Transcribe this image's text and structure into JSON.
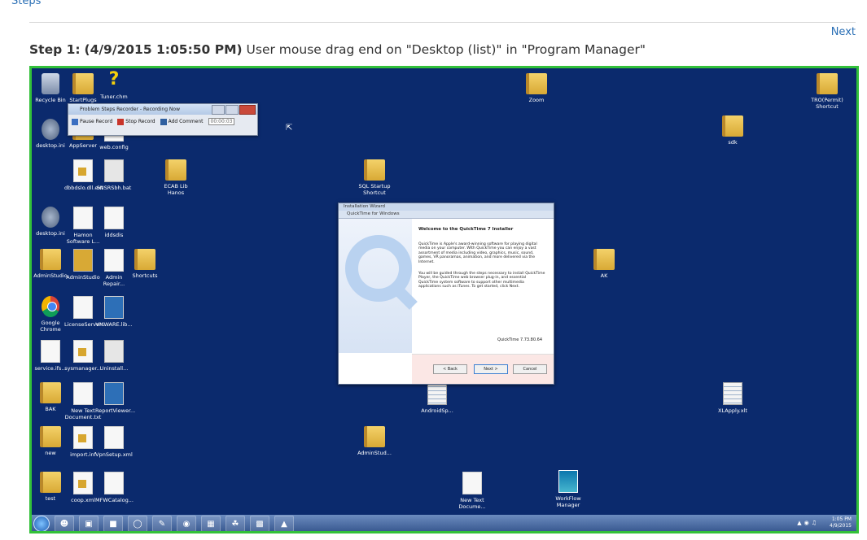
{
  "top_link": "Steps",
  "nav": {
    "next_label": "Next"
  },
  "step": {
    "prefix": "Step 1:",
    "timestamp": "(4/9/2015 1:05:50 PM)",
    "description": "User mouse drag end on \"Desktop (list)\" in \"Program Manager\""
  },
  "desktop_icons": [
    {
      "id": "recycle-bin",
      "label": "Recycle Bin",
      "icon": "bin"
    },
    {
      "id": "startplugs",
      "label": "StartPlugs",
      "icon": "folder"
    },
    {
      "id": "tuner-chm",
      "label": "Tuner.chm",
      "icon": "qmark"
    },
    {
      "id": "zoom",
      "label": "Zoom",
      "icon": "folder"
    },
    {
      "id": "tro-shortcut",
      "label": "TRO(Permit) Shortcut",
      "icon": "folder"
    },
    {
      "id": "desktop-ini-1",
      "label": "desktop.ini",
      "icon": "globe"
    },
    {
      "id": "appserver",
      "label": "AppServer",
      "icon": "folder"
    },
    {
      "id": "web-config",
      "label": "web.config",
      "icon": "doc"
    },
    {
      "id": "sdk",
      "label": "sdk",
      "icon": "folder"
    },
    {
      "id": "sql-lic",
      "label": "dbbdslo.dll.ext",
      "icon": "docy"
    },
    {
      "id": "sqlsetup",
      "label": "SNSRSbh.bat",
      "icon": "cfg"
    },
    {
      "id": "ecab-shares",
      "label": "ECAB Lib Hanos",
      "icon": "folder"
    },
    {
      "id": "sql-startup",
      "label": "SQL Startup Shortcut",
      "icon": "folder"
    },
    {
      "id": "desktop-ini-2",
      "label": "desktop.ini",
      "icon": "globe"
    },
    {
      "id": "hamon-software",
      "label": "Hamon Software L...",
      "icon": "doc"
    },
    {
      "id": "iddsdis",
      "label": "iddsdis",
      "icon": "doc"
    },
    {
      "id": "admin-studio",
      "label": "AdminStudio",
      "icon": "folder"
    },
    {
      "id": "admin-studio-2",
      "label": "AdminStudio",
      "icon": "cfg"
    },
    {
      "id": "admin-repair",
      "label": "Admin Repair...",
      "icon": "doc"
    },
    {
      "id": "shortcuts",
      "label": "Shortcuts",
      "icon": "folder"
    },
    {
      "id": "ak",
      "label": "AK",
      "icon": "folder"
    },
    {
      "id": "google-chrome",
      "label": "Google Chrome",
      "icon": "chrome"
    },
    {
      "id": "license-server",
      "label": "LicenseServer...",
      "icon": "doc"
    },
    {
      "id": "vmware-file",
      "label": "VMWARE.lib...",
      "icon": "mw"
    },
    {
      "id": "service-file",
      "label": "service.ifs...",
      "icon": "doc"
    },
    {
      "id": "sysmanager",
      "label": "sysmanager...",
      "icon": "docy"
    },
    {
      "id": "uninstall",
      "label": "Uninstall...",
      "icon": "cfg"
    },
    {
      "id": "bak",
      "label": "BAK",
      "icon": "folder"
    },
    {
      "id": "new-text-doc-1",
      "label": "New Text Document.txt",
      "icon": "doc"
    },
    {
      "id": "report-viewer",
      "label": "ReportViewer...",
      "icon": "mw"
    },
    {
      "id": "android-sp",
      "label": "AndroidSp...",
      "icon": "sheet"
    },
    {
      "id": "xl-apply",
      "label": "XLApply.xlt",
      "icon": "sheet"
    },
    {
      "id": "new",
      "label": "new",
      "icon": "folder"
    },
    {
      "id": "import-info",
      "label": "import.inf",
      "icon": "docy"
    },
    {
      "id": "vpn-setup",
      "label": "VpnSetup.xml",
      "icon": "doc"
    },
    {
      "id": "admin-studio-3",
      "label": "AdminStud...",
      "icon": "folder"
    },
    {
      "id": "test",
      "label": "test",
      "icon": "folder"
    },
    {
      "id": "coopxml",
      "label": "coop.xml",
      "icon": "docy"
    },
    {
      "id": "mfw-config",
      "label": "MFWCatalog...",
      "icon": "doc"
    },
    {
      "id": "new-text-doc-2",
      "label": "New Text Docume...",
      "icon": "doc"
    },
    {
      "id": "workflow-manager",
      "label": "WorkFlow Manager",
      "icon": "wfm"
    }
  ],
  "recorder": {
    "title": "Problem Steps Recorder - Recording Now",
    "pause": "Pause Record",
    "stop": "Stop Record",
    "comment": "Add Comment",
    "timer": "00:00:03"
  },
  "installer": {
    "title_outer": "Installation Wizard",
    "title_inner": "QuickTime for Windows",
    "heading": "Welcome to the QuickTime 7 Installer",
    "para1": "QuickTime is Apple's award-winning software for playing digital media on your computer. With QuickTime you can enjoy a vast assortment of media including video, graphics, music, sound, games, VR panoramas, animation, and more delivered via the Internet.",
    "para2": "You will be guided through the steps necessary to install QuickTime Player, the QuickTime web browser plug-in, and essential QuickTime system software to support other multimedia applications such as iTunes. To get started, click Next.",
    "version": "QuickTime 7.73.80.64",
    "back": "< Back",
    "next": "Next >",
    "cancel": "Cancel"
  },
  "taskbar": {
    "time": "1:05 PM",
    "date": "4/9/2015"
  }
}
